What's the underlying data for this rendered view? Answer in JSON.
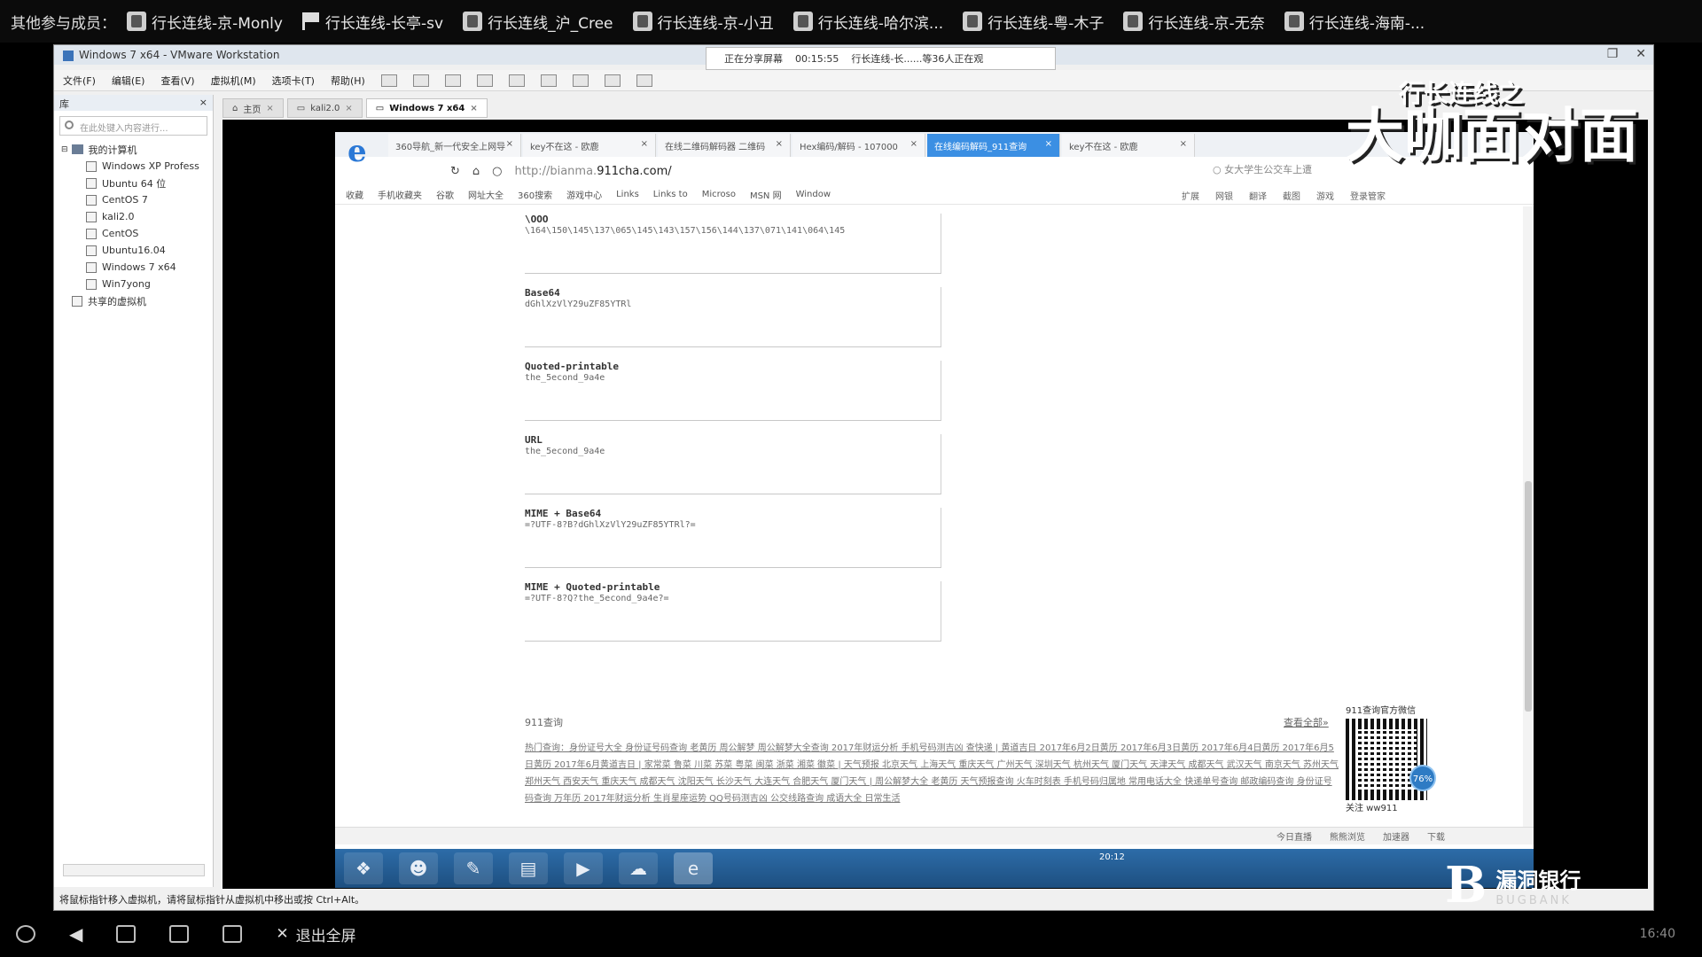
{
  "topbar": {
    "label": "其他参与成员：",
    "participants": [
      "行长连线-京-Monly",
      "行长连线-长亭-sv",
      "行长连线_沪_Cree",
      "行长连线-京-小丑",
      "行长连线-哈尔滨...",
      "行长连线-粤-木子",
      "行长连线-京-无奈",
      "行长连线-海南-..."
    ]
  },
  "vmware": {
    "title": "Windows 7 x64 - VMware Workstation",
    "share_status": "正在分享屏幕",
    "share_time": "00:15:55",
    "share_info": "行长连线-长......等36人正在观",
    "menu": [
      "文件(F)",
      "编辑(E)",
      "查看(V)",
      "虚拟机(M)",
      "选项卡(T)",
      "帮助(H)"
    ],
    "library_title": "库",
    "library_search_placeholder": "在此处键入内容进行...",
    "tree_root": "我的计算机",
    "vms": [
      "Windows XP Profess",
      "Ubuntu 64 位",
      "CentOS 7",
      "kali2.0",
      "CentOS",
      "Ubuntu16.04",
      "Windows 7 x64",
      "Win7yong"
    ],
    "shared_vms": "共享的虚拟机",
    "tabs": [
      {
        "label": "主页"
      },
      {
        "label": "kali2.0"
      },
      {
        "label": "Windows 7 x64"
      }
    ],
    "hint": "将鼠标指针移入虚拟机，请将鼠标指针从虚拟机中移出或按 Ctrl+Alt。"
  },
  "browser": {
    "tabs": [
      "360导航_新一代安全上网导",
      "key不在这 - 欧鹿",
      "在线二维码解码器 二维码",
      "Hex编码/解码 - 107000",
      "在线编码解码_911查询",
      "key不在这 - 欧鹿"
    ],
    "url_prefix": "http://bianma.",
    "url_domain": "911cha.com/",
    "search_hint": "女大学生公交车上遭",
    "favorites": [
      "收藏",
      "手机收藏夹",
      "谷歌",
      "网址大全",
      "360搜索",
      "游戏中心",
      "Links",
      "Links to",
      "Microso",
      "MSN 网",
      "Window"
    ],
    "fav_right": [
      "扩展",
      "网银",
      "翻译",
      "截图",
      "游戏",
      "登录管家"
    ]
  },
  "encodings": [
    {
      "label": "\\OOO",
      "value": "\\164\\150\\145\\137\\065\\145\\143\\157\\156\\144\\137\\071\\141\\064\\145"
    },
    {
      "label": "Base64",
      "value": "dGhlXzVlY29uZF85YTRl"
    },
    {
      "label": "Quoted-printable",
      "value": "the_5econd_9a4e"
    },
    {
      "label": "URL",
      "value": "the_5econd_9a4e"
    },
    {
      "label": "MIME + Base64",
      "value": "=?UTF-8?B?dGhlXzVlY29uZF85YTRl?="
    },
    {
      "label": "MIME + Quoted-printable",
      "value": "=?UTF-8?Q?the_5econd_9a4e?="
    }
  ],
  "footer": {
    "head": "911查询",
    "more": "查看全部»",
    "hot": "热门查询：身份证号大全 身份证号码查询 老黄历 周公解梦 周公解梦大全查询 2017年财运分析 手机号码测吉凶 查快递 | 黄道吉日 2017年6月2日黄历 2017年6月3日黄历 2017年6月4日黄历 2017年6月5日黄历 2017年6月黄道吉日 | 家常菜 鲁菜 川菜 苏菜 粤菜 闽菜 浙菜 湘菜 徽菜 | 天气预报 北京天气 上海天气 重庆天气 广州天气 深圳天气 杭州天气 厦门天气 天津天气 成都天气 武汉天气 南京天气 苏州天气 郑州天气 西安天气 重庆天气 成都天气 沈阳天气 长沙天气 大连天气 合肥天气 厦门天气 | 周公解梦大全 老黄历 天气预报查询 火车时刻表 手机号码归属地 常用电话大全 快递单号查询 邮政编码查询 身份证号码查询 万年历 2017年财运分析 生肖星座运势 QQ号码测吉凶 公交线路查询 成语大全 日常生活",
    "qr_title": "911查询官方微信",
    "qr_caption": "关注 ww911",
    "qr_pct": "76%"
  },
  "status": [
    "今日直播",
    "熊熊浏览",
    "加速器",
    "下载"
  ],
  "taskbar": {
    "clock": "20:12"
  },
  "bottombar": {
    "exit_fullscreen": "退出全屏",
    "time": "16:40"
  },
  "watermark": {
    "top_small": "行长连线之",
    "top_big": "大咖面对面",
    "bottom_name": "漏洞银行",
    "bottom_en": "BUGBANK"
  }
}
